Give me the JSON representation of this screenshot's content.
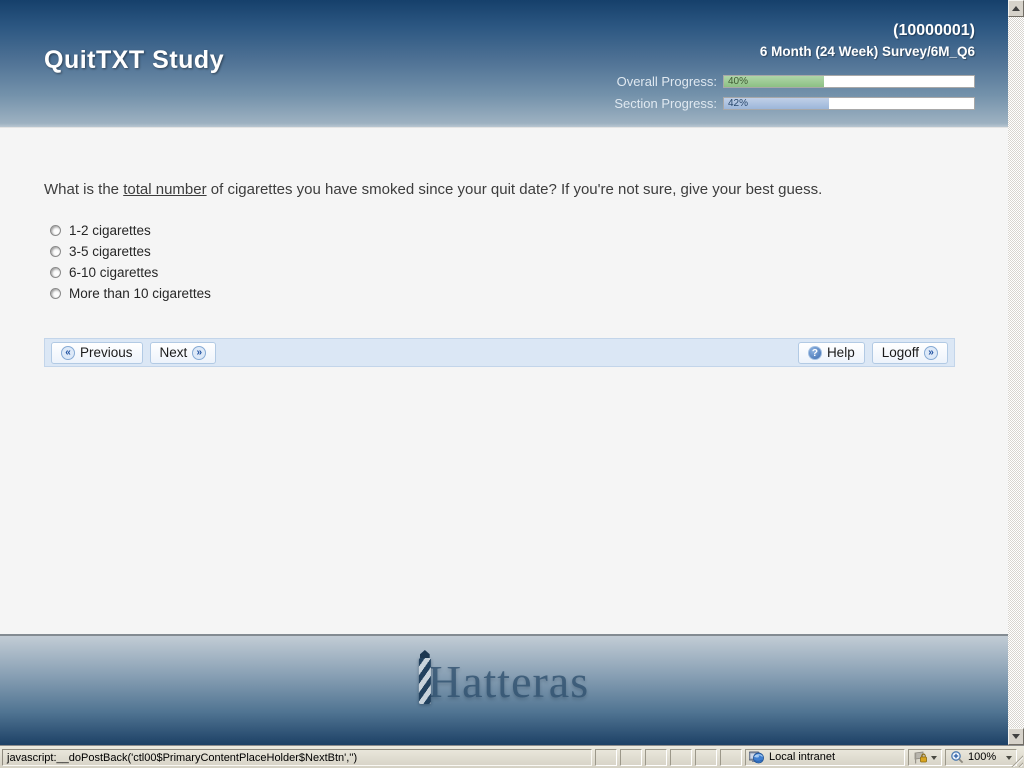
{
  "header": {
    "title": "QuitTXT Study",
    "participant_id": "(10000001)",
    "survey_name": "6 Month (24 Week) Survey/6M_Q6",
    "overall_progress": {
      "label": "Overall Progress:",
      "value": "40%",
      "fill_style": "width:40%"
    },
    "section_progress": {
      "label": "Section Progress:",
      "value": "42%",
      "fill_style": "width:42%"
    }
  },
  "question": {
    "prefix": "What is the ",
    "emphasis": "total number",
    "suffix": " of cigarettes you have smoked since your quit date? If you're not sure, give your best guess.",
    "options": [
      {
        "label": "1-2 cigarettes"
      },
      {
        "label": "3-5 cigarettes"
      },
      {
        "label": "6-10 cigarettes"
      },
      {
        "label": "More than 10 cigarettes"
      }
    ]
  },
  "toolbar": {
    "previous": "Previous",
    "next": "Next",
    "help": "Help",
    "logoff": "Logoff"
  },
  "footer": {
    "logo_text": "Hatteras"
  },
  "status_bar": {
    "link_text": "javascript:__doPostBack('ctl00$PrimaryContentPlaceHolder$NextBtn','')",
    "zone_label": "Local intranet",
    "zoom_level": "100%"
  },
  "icons": {
    "previous": "«",
    "next": "»",
    "logoff": "»",
    "help": "?"
  },
  "colors": {
    "header_top": "#16406b",
    "header_bottom": "#b9c6d1",
    "progress_green": "#8cc084",
    "progress_blue": "#9cb6d9",
    "toolbar_bg": "#dbe7f5",
    "footer_bottom": "#1d4166"
  }
}
